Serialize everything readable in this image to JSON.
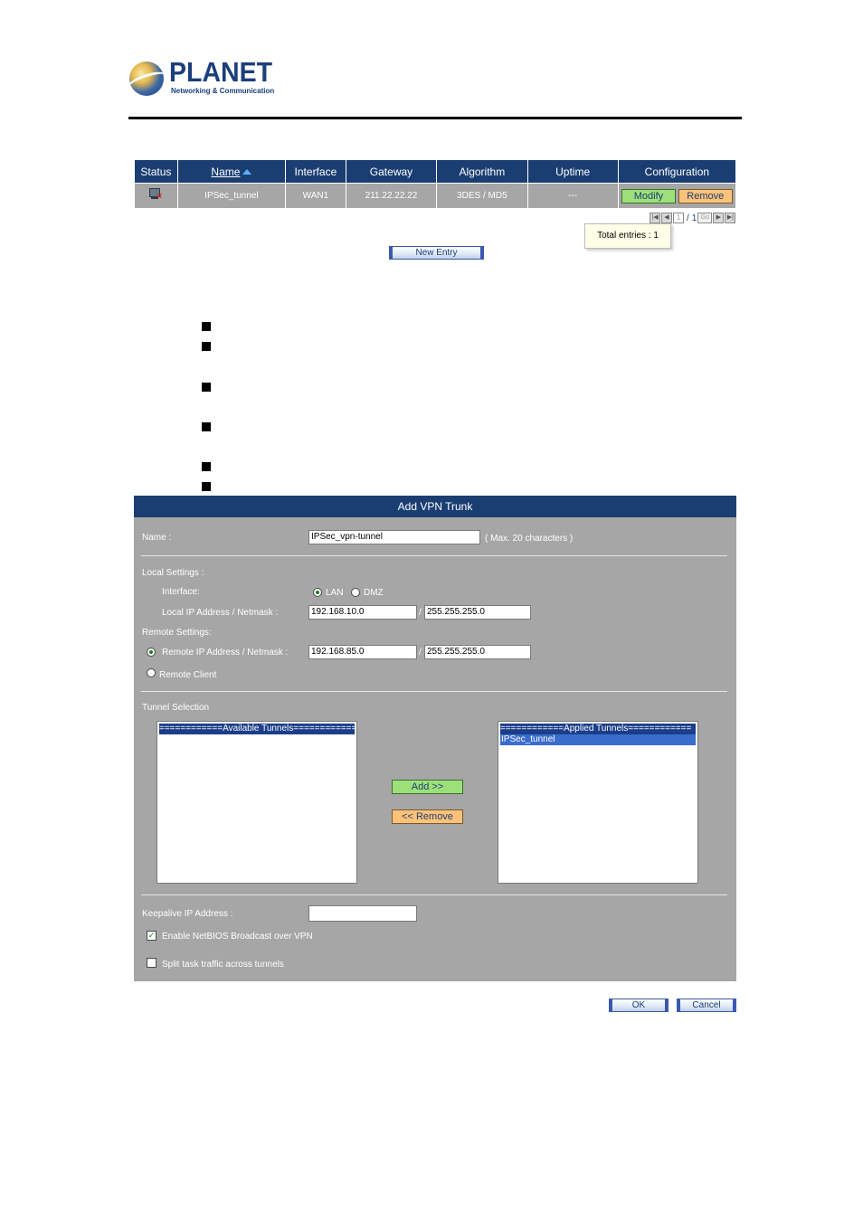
{
  "logo": {
    "title": "PLANET",
    "subtitle": "Networking & Communication"
  },
  "tunnel_table": {
    "columns": [
      "Status",
      "Name",
      "Interface",
      "Gateway",
      "Algorithm",
      "Uptime",
      "Configuration"
    ],
    "rows": [
      {
        "name": "IPSec_tunnel",
        "interface": "WAN1",
        "gateway": "211.22.22.22",
        "algorithm": "3DES / MD5",
        "uptime": "---",
        "modify_label": "Modify",
        "remove_label": "Remove"
      }
    ]
  },
  "pager": {
    "current_page": "1",
    "separator": "/",
    "total_pages": "1",
    "go_label": "Go"
  },
  "tooltip": "Total entries : 1",
  "new_entry_label": "New Entry",
  "vpn_trunk": {
    "header": "Add VPN Trunk",
    "name_label": "Name :",
    "name_value": "IPSec_vpn-tunnel",
    "name_hint": "( Max. 20 characters )",
    "local_settings_label": "Local Settings :",
    "interface_label": "Interface:",
    "interface_options": [
      "LAN",
      "DMZ"
    ],
    "interface_selected": "LAN",
    "local_ip_label": "Local IP Address / Netmask :",
    "local_ip": "192.168.10.0",
    "local_netmask": "255.255.255.0",
    "slash": "/",
    "remote_settings_label": "Remote Settings:",
    "remote_ip_label": "Remote IP Address / Netmask :",
    "remote_ip": "192.168.85.0",
    "remote_netmask": "255.255.255.0",
    "remote_client_label": "Remote Client",
    "tunnel_selection_label": "Tunnel Selection",
    "available_header": "============Available Tunnels============",
    "applied_header": "============Applied Tunnels============",
    "applied_items": [
      "IPSec_tunnel"
    ],
    "add_label": "Add >>",
    "remove_label": "<< Remove",
    "keepalive_label": "Keepalive IP Address :",
    "keepalive_value": "",
    "netbios_label": "Enable NetBIOS Broadcast over VPN",
    "netbios_checked": true,
    "split_label": "Split task traffic across tunnels",
    "split_checked": false
  },
  "ok_label": "OK",
  "cancel_label": "Cancel",
  "colors": {
    "header_blue": "#1b3e72",
    "panel_gray": "#a6a6a6",
    "green_button": "#9de07a",
    "orange_button": "#ffc27a"
  }
}
